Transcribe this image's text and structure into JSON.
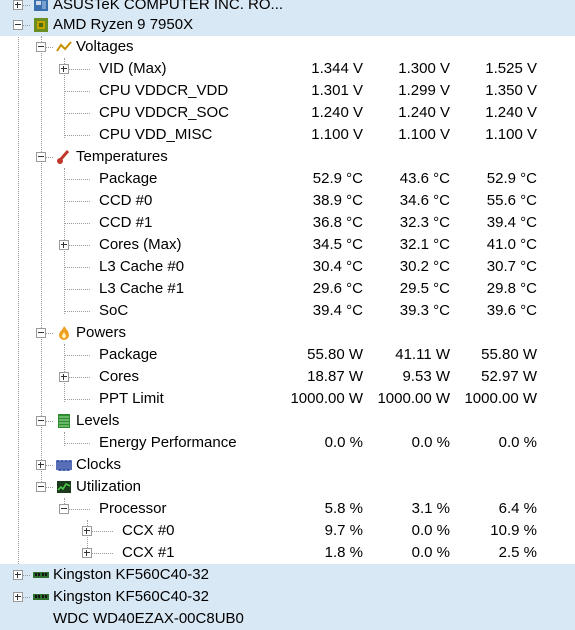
{
  "nodes": {
    "asus": "ASUSTeK COMPUTER INC. RO...",
    "cpu": "AMD Ryzen 9 7950X",
    "kingston1": "Kingston KF560C40-32",
    "kingston2": "Kingston KF560C40-32",
    "wdc": "WDC WD40EZAX-00C8UB0"
  },
  "groups": {
    "voltages": "Voltages",
    "temperatures": "Temperatures",
    "powers": "Powers",
    "levels": "Levels",
    "clocks": "Clocks",
    "utilization": "Utilization"
  },
  "voltages": [
    {
      "label": "VID (Max)",
      "v1": "1.344 V",
      "v2": "1.300 V",
      "v3": "1.525 V"
    },
    {
      "label": "CPU VDDCR_VDD",
      "v1": "1.301 V",
      "v2": "1.299 V",
      "v3": "1.350 V"
    },
    {
      "label": "CPU VDDCR_SOC",
      "v1": "1.240 V",
      "v2": "1.240 V",
      "v3": "1.240 V"
    },
    {
      "label": "CPU VDD_MISC",
      "v1": "1.100 V",
      "v2": "1.100 V",
      "v3": "1.100 V"
    }
  ],
  "temperatures": [
    {
      "label": "Package",
      "v1": "52.9 °C",
      "v2": "43.6 °C",
      "v3": "52.9 °C"
    },
    {
      "label": "CCD #0",
      "v1": "38.9 °C",
      "v2": "34.6 °C",
      "v3": "55.6 °C"
    },
    {
      "label": "CCD #1",
      "v1": "36.8 °C",
      "v2": "32.3 °C",
      "v3": "39.4 °C"
    },
    {
      "label": "Cores (Max)",
      "v1": "34.5 °C",
      "v2": "32.1 °C",
      "v3": "41.0 °C"
    },
    {
      "label": "L3 Cache #0",
      "v1": "30.4 °C",
      "v2": "30.2 °C",
      "v3": "30.7 °C"
    },
    {
      "label": "L3 Cache #1",
      "v1": "29.6 °C",
      "v2": "29.5 °C",
      "v3": "29.8 °C"
    },
    {
      "label": "SoC",
      "v1": "39.4 °C",
      "v2": "39.3 °C",
      "v3": "39.6 °C"
    }
  ],
  "powers": [
    {
      "label": "Package",
      "v1": "55.80 W",
      "v2": "41.11 W",
      "v3": "55.80 W"
    },
    {
      "label": "Cores",
      "v1": "18.87 W",
      "v2": "9.53 W",
      "v3": "52.97 W"
    },
    {
      "label": "PPT Limit",
      "v1": "1000.00 W",
      "v2": "1000.00 W",
      "v3": "1000.00 W"
    }
  ],
  "levels": [
    {
      "label": "Energy Performance",
      "v1": "0.0 %",
      "v2": "0.0 %",
      "v3": "0.0 %"
    }
  ],
  "utilization": {
    "processor": {
      "label": "Processor",
      "v1": "5.8 %",
      "v2": "3.1 %",
      "v3": "6.4 %"
    },
    "ccx0": {
      "label": "CCX #0",
      "v1": "9.7 %",
      "v2": "0.0 %",
      "v3": "10.9 %"
    },
    "ccx1": {
      "label": "CCX #1",
      "v1": "1.8 %",
      "v2": "0.0 %",
      "v3": "2.5 %"
    }
  },
  "colors": {
    "selection": "#d9e8f5",
    "tree_lines": "#9a9a9a"
  },
  "icons": {
    "motherboard": "motherboard-icon",
    "cpu": "cpu-chip-icon",
    "voltages": "voltage-icon",
    "temperatures": "thermometer-icon",
    "powers": "flame-icon",
    "levels": "level-bar-icon",
    "clocks": "clock-wave-icon",
    "utilization": "utilization-graph-icon",
    "memory": "ram-stick-icon"
  }
}
